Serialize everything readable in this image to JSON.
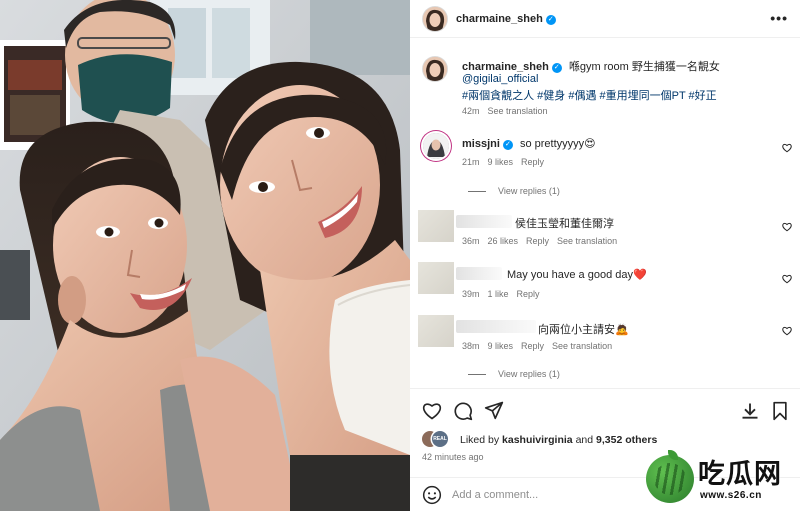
{
  "post": {
    "author": "charmaine_sheh",
    "verified_mark": "✓",
    "more_icon": "more-horizontal-icon",
    "caption_text": "喺gym room 野生捕獲一名靚女",
    "mention": "@gigilai_official",
    "hashtags": "#兩個貪靚之人 #健身 #偶遇 #重用埋同一個PT #好正",
    "caption_time": "42m",
    "caption_translate": "See translation"
  },
  "comments": [
    {
      "user": "missjni",
      "verified": true,
      "text": "so prettyyyyy😍",
      "time": "21m",
      "likes": "9 likes",
      "reply": "Reply",
      "view_replies": "View replies (1)"
    },
    {
      "user": "",
      "text": "侯佳玉瑩和董佳爾淳",
      "time": "36m",
      "likes": "26 likes",
      "reply": "Reply",
      "translate": "See translation"
    },
    {
      "user": "",
      "text": "May you have a good day❤️",
      "time": "39m",
      "likes": "1 like",
      "reply": "Reply"
    },
    {
      "user": "",
      "text": "向兩位小主請安🙇",
      "time": "38m",
      "likes": "9 likes",
      "reply": "Reply",
      "translate": "See translation",
      "view_replies": "View replies (1)"
    }
  ],
  "actions": {
    "icons": [
      "heart-icon",
      "comment-icon",
      "share-icon",
      "download-icon",
      "bookmark-icon"
    ],
    "liked_by_prefix": "Liked by",
    "liked_by_user": "kashuivirginia",
    "liked_by_and": "and",
    "liked_by_count": "9,352 others",
    "posted_ago": "42 minutes ago",
    "comment_placeholder": "Add a comment...",
    "emoji_icon": "smiley-icon",
    "avatar_badge": "REAL"
  },
  "watermark": {
    "text": "吃瓜网",
    "url": "www.s26.cn"
  },
  "colors": {
    "link": "#00376b",
    "verified": "#0095f6",
    "muted": "#737373",
    "like_red": "#ed4956"
  }
}
